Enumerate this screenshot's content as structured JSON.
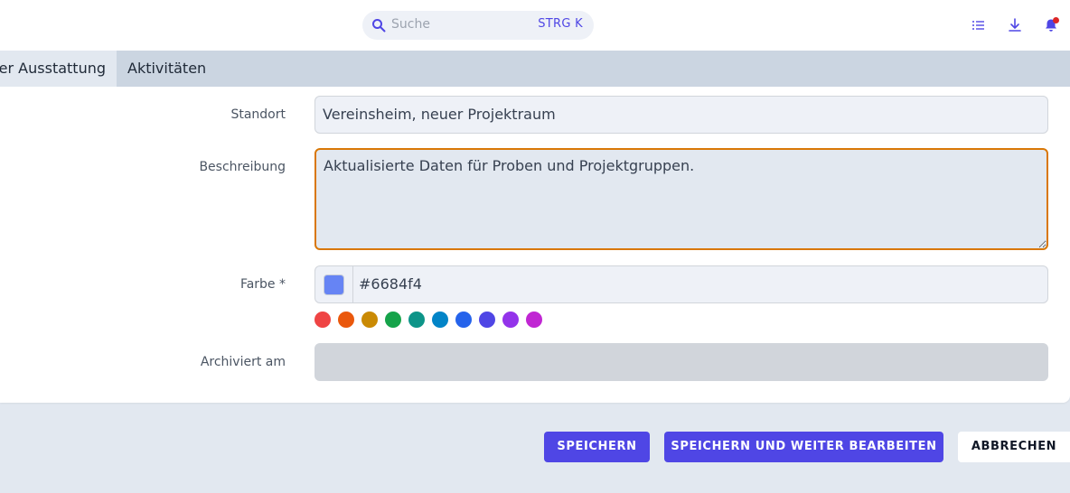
{
  "search": {
    "placeholder": "Suche",
    "shortcut": "STRG K"
  },
  "topbar_icons": [
    "list-icon",
    "download-icon",
    "bell-icon"
  ],
  "tabs": [
    {
      "label": "er Ausstattung",
      "active": true
    },
    {
      "label": "Aktivitäten",
      "active": false
    }
  ],
  "form": {
    "standort": {
      "label": "Standort",
      "value": "Vereinsheim, neuer Projektraum"
    },
    "beschreibung": {
      "label": "Beschreibung",
      "value": "Aktualisierte Daten für Proben und Projektgruppen."
    },
    "farbe": {
      "label": "Farbe *",
      "value": "#6684f4",
      "presets": [
        "#ef4444",
        "#ea580c",
        "#ca8a04",
        "#16a34a",
        "#0d9488",
        "#0284c7",
        "#2563eb",
        "#4f46e5",
        "#9333ea",
        "#c026d3"
      ]
    },
    "archiviert": {
      "label": "Archiviert am",
      "value": ""
    }
  },
  "buttons": {
    "save": "SPEICHERN",
    "save_continue": "SPEICHERN UND WEITER BEARBEITEN",
    "cancel": "ABBRECHEN"
  },
  "colors": {
    "accent": "#4f46e5",
    "focus_border": "#d97706",
    "notification_dot": "#dc2626"
  }
}
